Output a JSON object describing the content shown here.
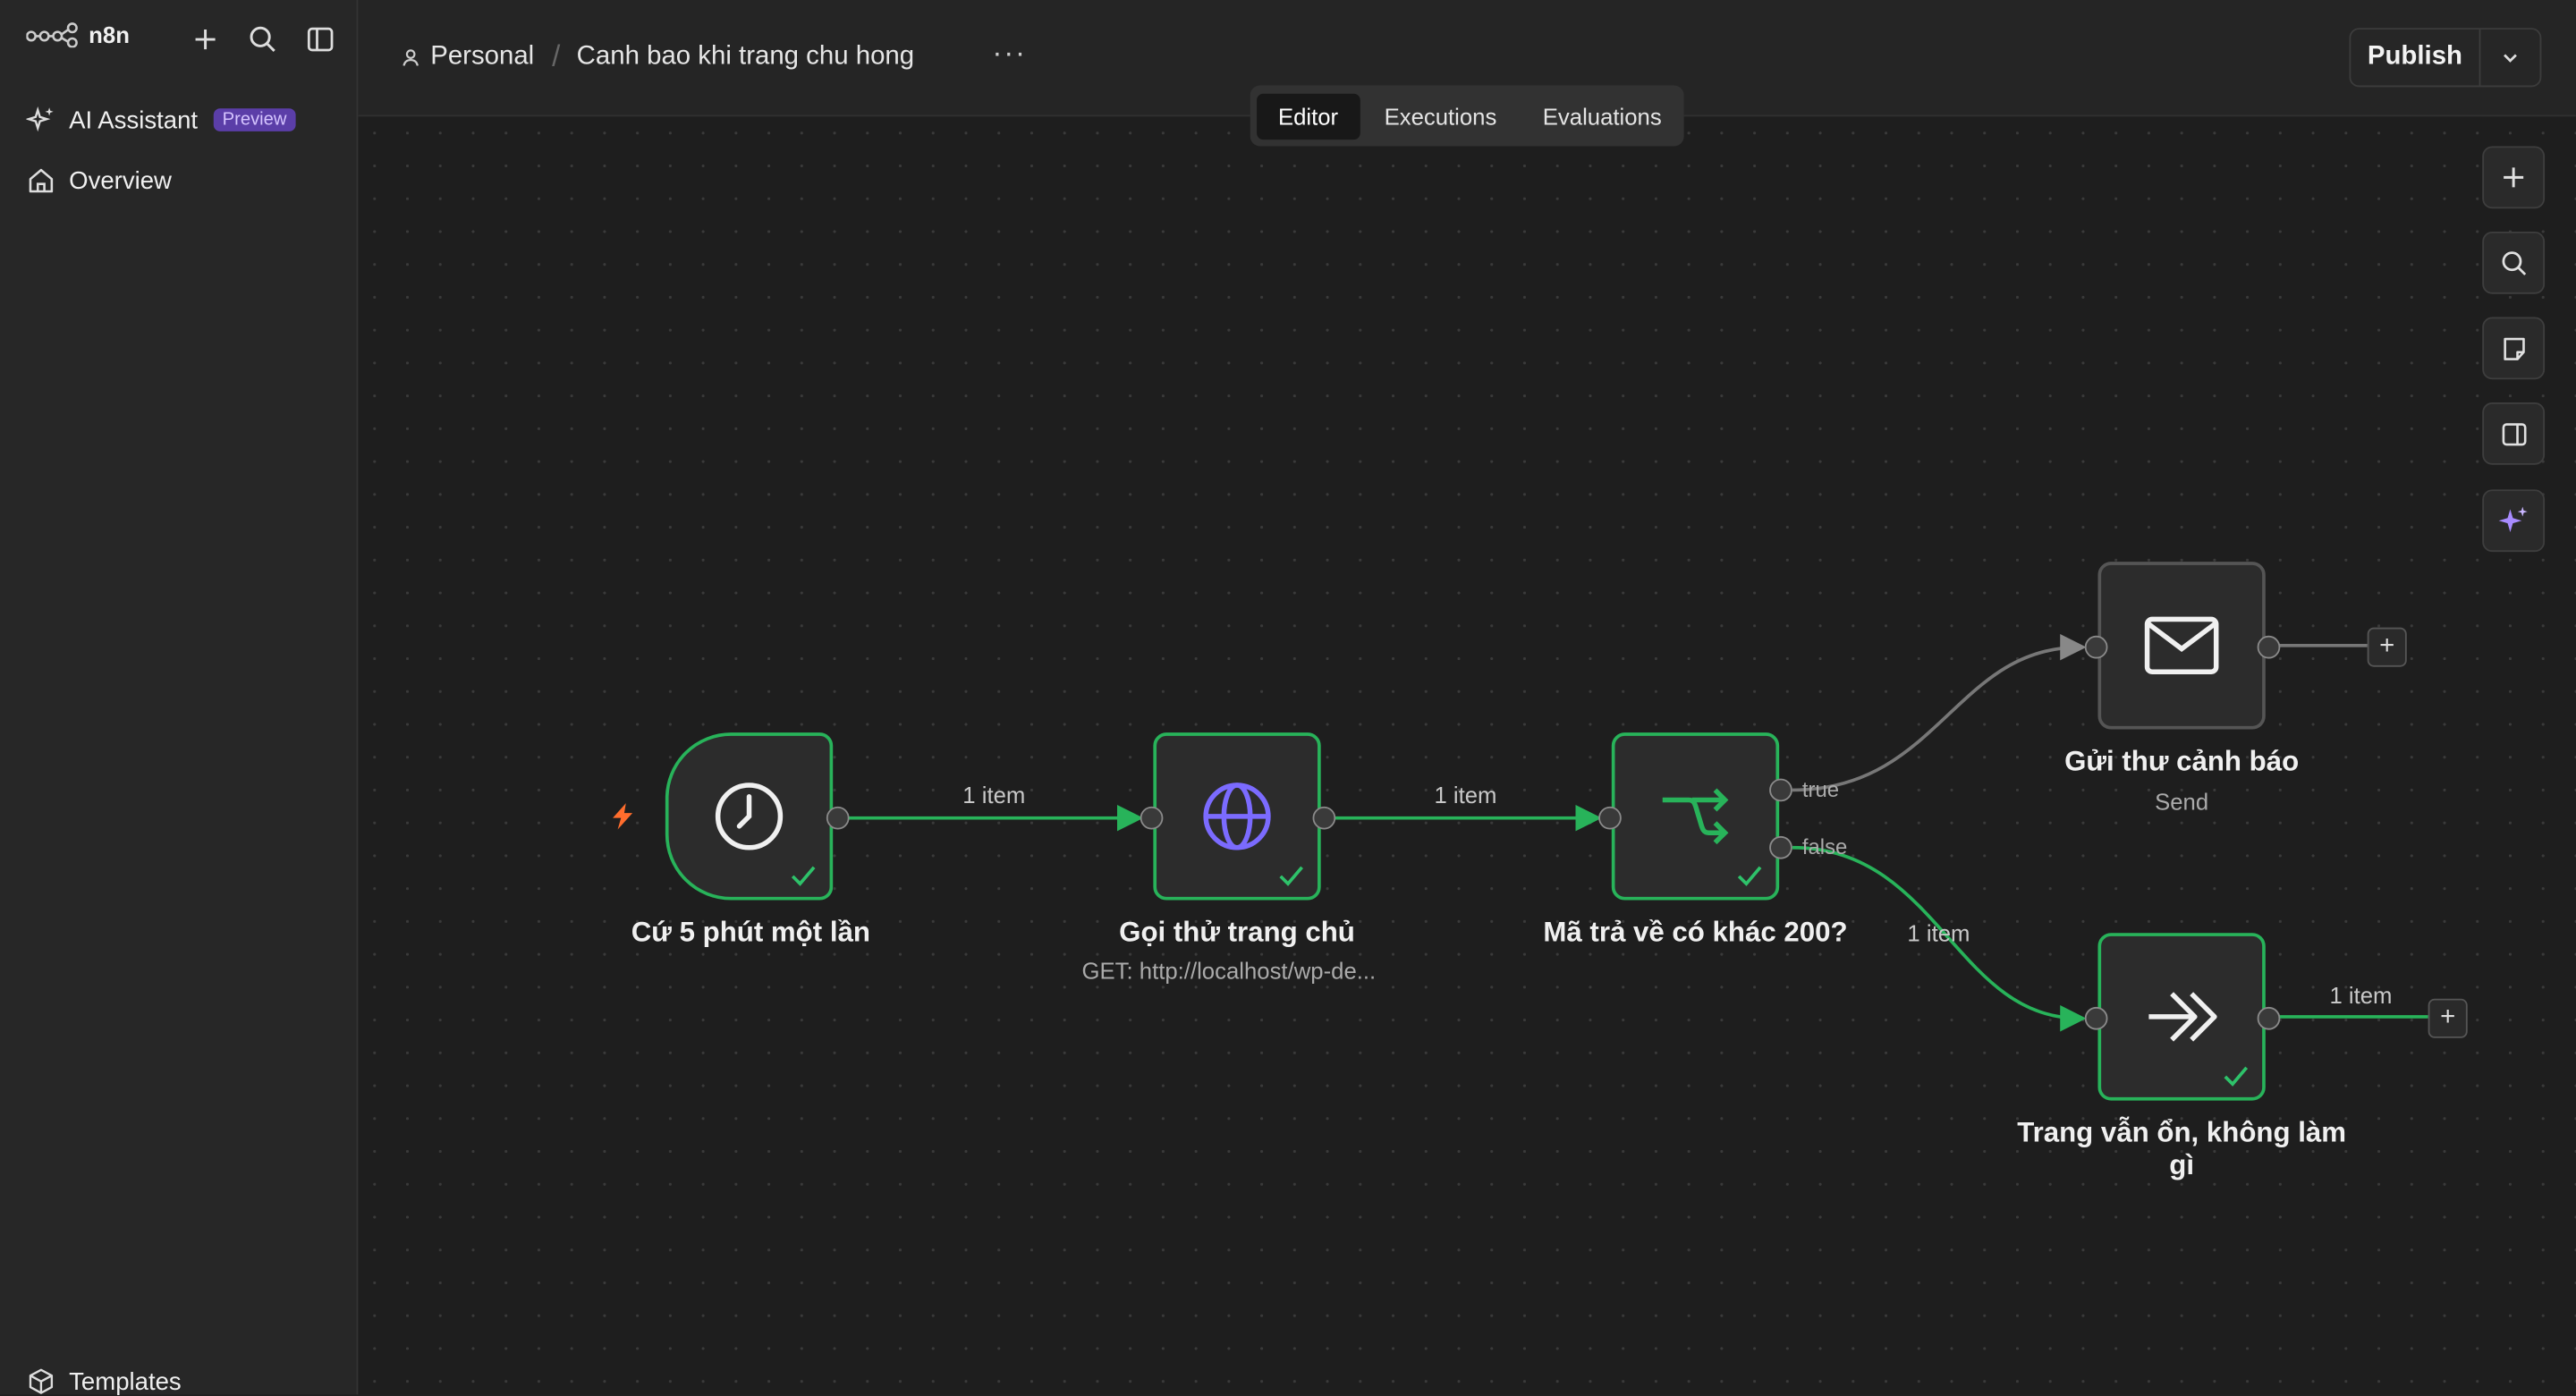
{
  "app": {
    "brand": "n8n"
  },
  "sidebar": {
    "items": [
      {
        "label": "AI Assistant",
        "badge": "Preview",
        "icon": "sparkles-icon"
      },
      {
        "label": "Overview",
        "icon": "home-icon"
      }
    ],
    "footer": {
      "label": "Templates",
      "icon": "box-icon"
    }
  },
  "header": {
    "project": "Personal",
    "workflow_name": "Canh bao khi trang chu hong",
    "more": "···",
    "publish": "Publish"
  },
  "tabs": [
    {
      "label": "Editor",
      "active": true
    },
    {
      "label": "Executions",
      "active": false
    },
    {
      "label": "Evaluations",
      "active": false
    }
  ],
  "workflow": {
    "nodes": [
      {
        "id": "schedule",
        "label": "Cứ 5 phút một lần",
        "icon": "clock-icon",
        "status": "success"
      },
      {
        "id": "http",
        "label": "Gọi thử trang chủ",
        "subtitle": "GET: http://localhost/wp-de...",
        "icon": "globe-icon",
        "status": "success"
      },
      {
        "id": "if",
        "label": "Mã trả về có khác 200?",
        "icon": "branch-icon",
        "status": "success",
        "outputs": [
          "true",
          "false"
        ]
      },
      {
        "id": "email",
        "label": "Gửi thư cảnh báo",
        "subtitle": "Send",
        "icon": "envelope-icon",
        "status": "idle"
      },
      {
        "id": "noop",
        "label": "Trang vẫn ổn, không làm gì",
        "icon": "double-chevron-icon",
        "status": "success"
      }
    ],
    "edges": [
      {
        "from": "schedule",
        "to": "http",
        "label": "1 item"
      },
      {
        "from": "http",
        "to": "if",
        "label": "1 item"
      },
      {
        "from": "if.true",
        "to": "email",
        "label": ""
      },
      {
        "from": "if.false",
        "to": "noop",
        "label": "1 item"
      },
      {
        "from": "noop",
        "to": "end",
        "label": "1 item"
      }
    ]
  },
  "colors": {
    "success": "#28b35a",
    "trigger": "#ff6d2d",
    "accent": "#7b6bff"
  }
}
